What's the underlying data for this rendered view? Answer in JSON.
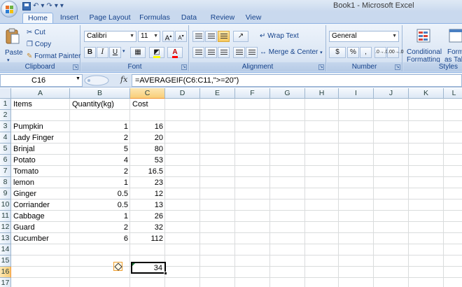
{
  "window": {
    "title": "Book1 - Microsoft Excel"
  },
  "tabs": [
    "Home",
    "Insert",
    "Page Layout",
    "Formulas",
    "Data",
    "Review",
    "View"
  ],
  "clipboard": {
    "paste": "Paste",
    "cut": "Cut",
    "copy": "Copy",
    "format_painter": "Format Painter",
    "label": "Clipboard"
  },
  "font": {
    "name": "Calibri",
    "size": "11",
    "bold": "B",
    "italic": "I",
    "underline": "U",
    "label": "Font"
  },
  "alignment": {
    "wrap_text": "Wrap Text",
    "merge_center": "Merge & Center",
    "label": "Alignment"
  },
  "number": {
    "format": "General",
    "currency": "$",
    "percent": "%",
    "comma": ",",
    "inc_decimal": ".0→.00",
    "dec_decimal": ".00→.0",
    "label": "Number"
  },
  "styles": {
    "conditional_1": "Conditional",
    "conditional_2": "Formatting",
    "format_table_1": "Form",
    "format_table_2": "as Tab",
    "label": "Styles"
  },
  "formula_bar": {
    "name_box": "C16",
    "fx": "fx",
    "formula": "=AVERAGEIF(C6:C11,\">=20\")"
  },
  "columns": [
    "A",
    "B",
    "C",
    "D",
    "E",
    "F",
    "G",
    "H",
    "I",
    "J",
    "K",
    "L"
  ],
  "rows": [
    "1",
    "2",
    "3",
    "4",
    "5",
    "6",
    "7",
    "8",
    "9",
    "10",
    "11",
    "12",
    "13",
    "14",
    "15",
    "16",
    "17"
  ],
  "selected": {
    "column": "C",
    "row": "16"
  },
  "headers": {
    "items": "Items",
    "quantity": "Quantity(kg)",
    "cost": "Cost"
  },
  "data": [
    {
      "row": "3",
      "item": "Pumpkin",
      "qty": "1",
      "cost": "16"
    },
    {
      "row": "4",
      "item": "Lady  Finger",
      "qty": "2",
      "cost": "20"
    },
    {
      "row": "5",
      "item": "Brinjal",
      "qty": "5",
      "cost": "80"
    },
    {
      "row": "6",
      "item": "Potato",
      "qty": "4",
      "cost": "53"
    },
    {
      "row": "7",
      "item": "Tomato",
      "qty": "2",
      "cost": "16.5"
    },
    {
      "row": "8",
      "item": "lemon",
      "qty": "1",
      "cost": "23"
    },
    {
      "row": "9",
      "item": "Ginger",
      "qty": "0.5",
      "cost": "12"
    },
    {
      "row": "10",
      "item": "Corriander",
      "qty": "0.5",
      "cost": "13"
    },
    {
      "row": "11",
      "item": "Cabbage",
      "qty": "1",
      "cost": "26"
    },
    {
      "row": "12",
      "item": "Guard",
      "qty": "2",
      "cost": "32"
    },
    {
      "row": "13",
      "item": "Cucumber",
      "qty": "6",
      "cost": "112"
    }
  ],
  "result": {
    "cell": "C16",
    "value": "34"
  },
  "colors": {
    "accent": "#15428b",
    "selection": "#f8cd78",
    "grid": "#dadcdd"
  }
}
